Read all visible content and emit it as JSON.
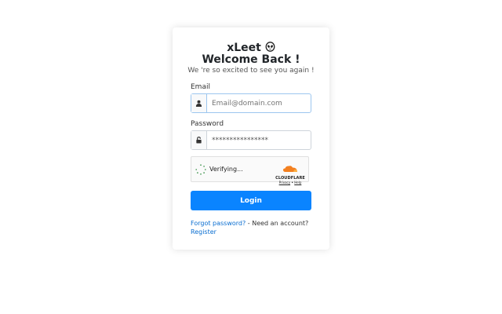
{
  "brand": {
    "name": "xLeet",
    "icon": "alien-emoji-icon"
  },
  "heading": "Welcome Back !",
  "subtitle": "We 're so excited to see you again !",
  "email": {
    "label": "Email",
    "placeholder": "Email@domain.com",
    "icon": "user-icon"
  },
  "password": {
    "label": "Password",
    "value": "****************",
    "icon": "unlock-icon"
  },
  "captcha": {
    "status": "Verifying...",
    "provider": "CLOUDFLARE",
    "privacy": "Privacy",
    "separator": "•",
    "help": "Help"
  },
  "login_button": "Login",
  "links": {
    "forgot": "Forgot password?",
    "separator": " - Need an account?",
    "register": "Register"
  },
  "colors": {
    "primary": "#0a84ff",
    "link": "#0a6ed1",
    "cloudflare_orange": "#f38020"
  }
}
